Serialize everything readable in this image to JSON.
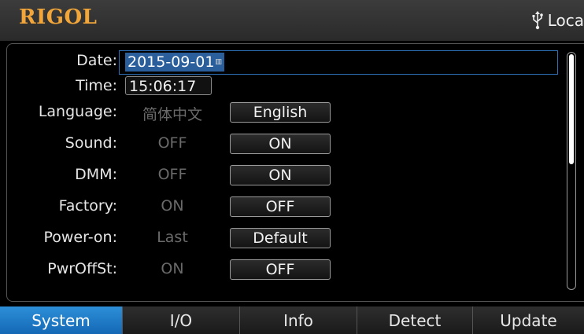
{
  "header": {
    "logo": "RIGOL",
    "status_icon": "usb-icon",
    "status_text": "Loca"
  },
  "settings": {
    "date": {
      "label": "Date:",
      "value": "2015-09-01"
    },
    "time": {
      "label": "Time:",
      "value": "15:06:17"
    },
    "rows": [
      {
        "label": "Language:",
        "alt": "简体中文",
        "button": "English"
      },
      {
        "label": "Sound:",
        "alt": "OFF",
        "button": "ON"
      },
      {
        "label": "DMM:",
        "alt": "OFF",
        "button": "ON"
      },
      {
        "label": "Factory:",
        "alt": "ON",
        "button": "OFF"
      },
      {
        "label": "Power-on:",
        "alt": "Last",
        "button": "Default"
      },
      {
        "label": "PwrOffSt:",
        "alt": "ON",
        "button": "OFF"
      }
    ]
  },
  "tabs": [
    {
      "label": "System",
      "active": true
    },
    {
      "label": "I/O",
      "active": false
    },
    {
      "label": "Info",
      "active": false
    },
    {
      "label": "Detect",
      "active": false
    },
    {
      "label": "Update",
      "active": false
    }
  ],
  "colors": {
    "logo": "#f2a63a",
    "active_tab": "#1f7fcc",
    "selection": "#2a5f9c"
  }
}
